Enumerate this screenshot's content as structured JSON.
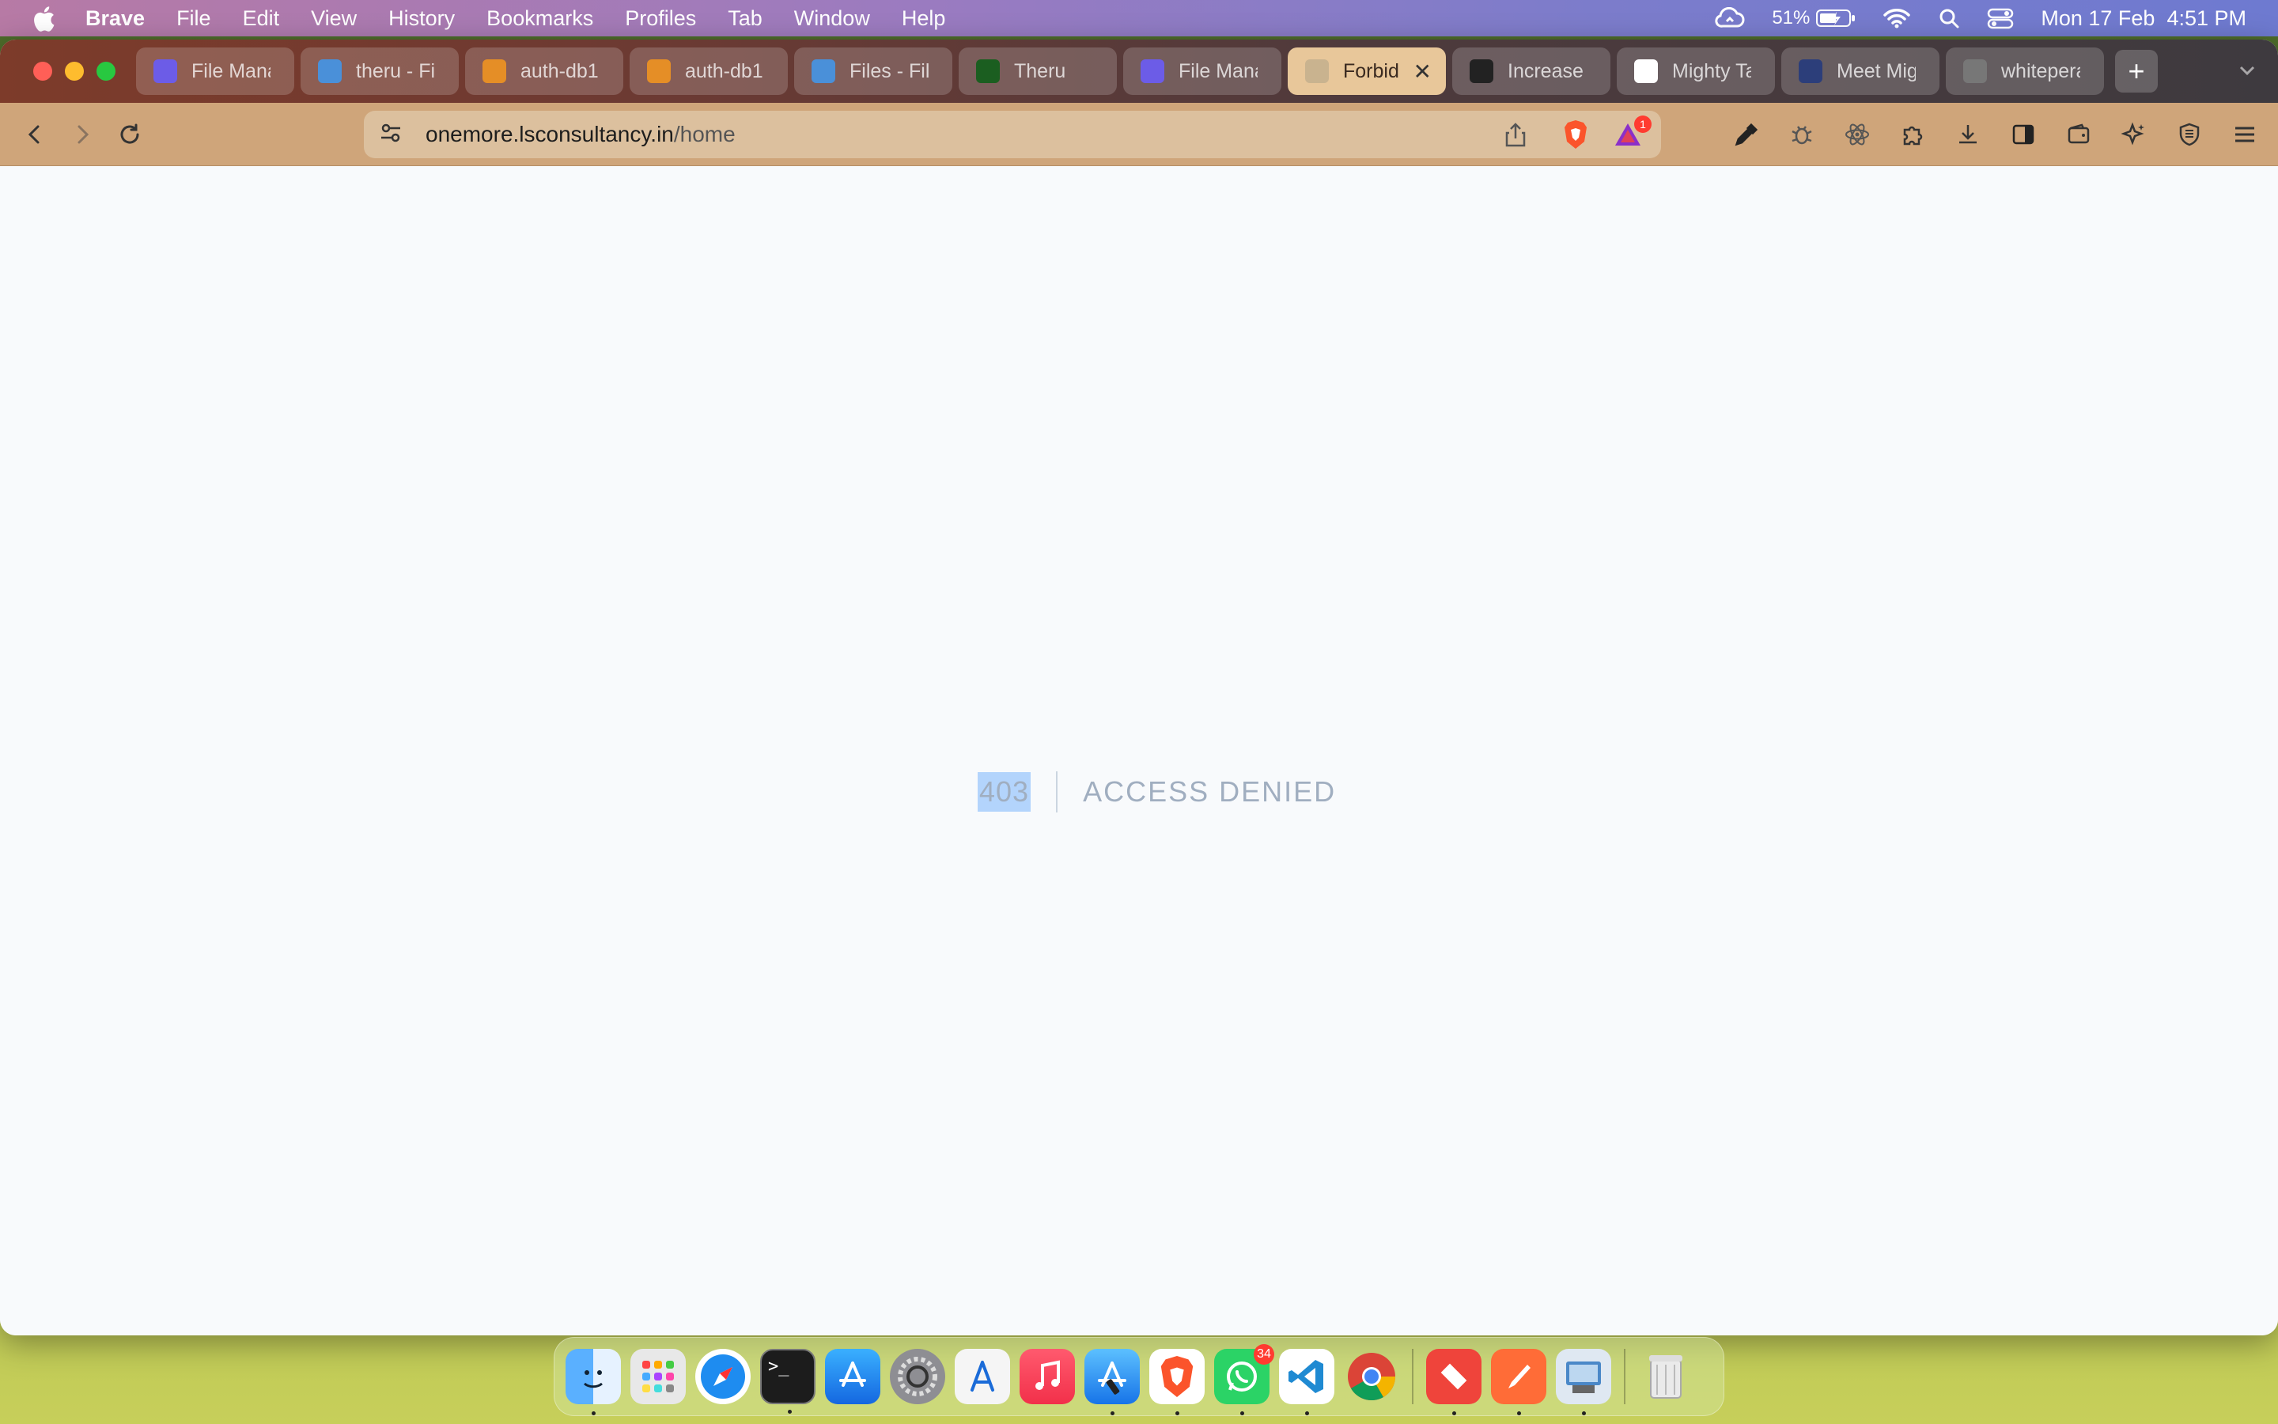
{
  "menubar": {
    "app_name": "Brave",
    "items": [
      "File",
      "Edit",
      "View",
      "History",
      "Bookmarks",
      "Profiles",
      "Tab",
      "Window",
      "Help"
    ],
    "battery_percent": "51%",
    "clock": "Mon 17 Feb  4:51 PM"
  },
  "tabs": [
    {
      "label": "File Mana",
      "icon": "bolt-icon",
      "color": "#6c5ce7"
    },
    {
      "label": "theru - Fi",
      "icon": "files-icon",
      "color": "#4a90d9"
    },
    {
      "label": "auth-db1",
      "icon": "wave-icon",
      "color": "#e58e26"
    },
    {
      "label": "auth-db1",
      "icon": "wave-icon",
      "color": "#e58e26"
    },
    {
      "label": "Files - Fil",
      "icon": "files-icon",
      "color": "#4a90d9"
    },
    {
      "label": "Theru",
      "icon": "terminal-icon",
      "color": "#1b5e20"
    },
    {
      "label": "File Mana",
      "icon": "bolt-icon",
      "color": "#6c5ce7"
    },
    {
      "label": "Forbid",
      "icon": "globe-icon",
      "color": "#c9b38f",
      "active": true
    },
    {
      "label": "Increase",
      "icon": "openai-icon",
      "color": "#222222"
    },
    {
      "label": "Mighty Ta",
      "icon": "g-icon",
      "color": "#ffffff"
    },
    {
      "label": "Meet Mig",
      "icon": "mountain-icon",
      "color": "#2c3e7a"
    },
    {
      "label": "whitepera",
      "icon": "globe-icon",
      "color": "#777777"
    }
  ],
  "address": {
    "host": "onemore.lsconsultancy.in",
    "path": "/home"
  },
  "rewards_badge": "1",
  "error": {
    "code": "403",
    "message": "ACCESS DENIED"
  },
  "dock": {
    "whatsapp_badge": "34"
  }
}
